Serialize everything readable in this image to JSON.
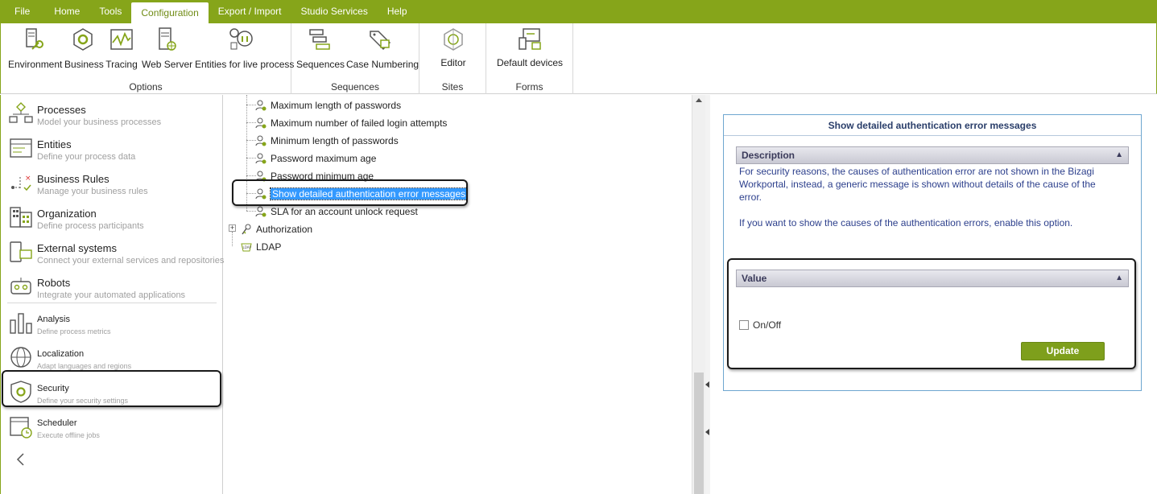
{
  "menu": {
    "items": [
      "File",
      "Home",
      "Tools",
      "Configuration",
      "Export / Import",
      "Studio Services",
      "Help"
    ],
    "active": "Configuration"
  },
  "ribbon": {
    "groups": [
      {
        "label": "Options",
        "buttons": [
          "Environment",
          "Business",
          "Tracing",
          "Web Server",
          "Entities for live process"
        ]
      },
      {
        "label": "Sequences",
        "buttons": [
          "Sequences",
          "Case Numbering"
        ]
      },
      {
        "label": "Sites",
        "buttons": [
          "Editor"
        ]
      },
      {
        "label": "Forms",
        "buttons": [
          "Default devices"
        ]
      }
    ]
  },
  "sidebar": {
    "items": [
      {
        "title": "Processes",
        "subtitle": "Model your business processes",
        "icon": "processes-icon"
      },
      {
        "title": "Entities",
        "subtitle": "Define your process data",
        "icon": "entities-icon"
      },
      {
        "title": "Business Rules",
        "subtitle": "Manage your business rules",
        "icon": "business-rules-icon"
      },
      {
        "title": "Organization",
        "subtitle": "Define process participants",
        "icon": "organization-icon"
      },
      {
        "title": "External systems",
        "subtitle": "Connect your external services and repositories",
        "icon": "external-systems-icon"
      },
      {
        "title": "Robots",
        "subtitle": "Integrate your automated applications",
        "icon": "robots-icon"
      },
      {
        "title": "Analysis",
        "subtitle": "Define process metrics",
        "icon": "analysis-icon"
      },
      {
        "title": "Localization",
        "subtitle": "Adapt languages and regions",
        "icon": "localization-icon"
      },
      {
        "title": "Security",
        "subtitle": "Define your security settings",
        "icon": "security-icon"
      },
      {
        "title": "Scheduler",
        "subtitle": "Execute offline jobs",
        "icon": "scheduler-icon"
      }
    ],
    "selected": "Security",
    "collapse_icon": "chevron-left-icon"
  },
  "tree": {
    "nodes": [
      {
        "label": "Maximum length of passwords",
        "icon": "user-setting-icon"
      },
      {
        "label": "Maximum number of failed login attempts",
        "icon": "user-setting-icon"
      },
      {
        "label": "Minimum length of passwords",
        "icon": "user-setting-icon"
      },
      {
        "label": "Password maximum age",
        "icon": "user-setting-icon"
      },
      {
        "label": "Password minimum age",
        "icon": "user-setting-icon"
      },
      {
        "label": "Show detailed authentication error messages",
        "icon": "user-setting-icon",
        "selected": true
      },
      {
        "label": "SLA for an account unlock request",
        "icon": "user-setting-icon"
      }
    ],
    "root_nodes": [
      {
        "label": "Authorization",
        "icon": "authorization-icon",
        "expander": "+"
      },
      {
        "label": "LDAP",
        "icon": "ldap-icon"
      }
    ],
    "ldap_icon_text": "LDAP"
  },
  "properties": {
    "title": "Show detailed authentication error messages",
    "description_header": "Description",
    "description_p1": "For security reasons, the causes of authentication error are not shown in the Bizagi Workportal, instead, a generic message is shown without details of the cause of the error.",
    "description_p2": "If you want to show the causes of the authentication errors, enable this option.",
    "value_header": "Value",
    "checkbox_label": "On/Off",
    "checkbox_checked": false,
    "update_label": "Update"
  },
  "colors": {
    "brand_green": "#86a51a",
    "button_green": "#7e9f1c",
    "selection_blue": "#3399ff",
    "title_navy": "#2a3e6a"
  }
}
